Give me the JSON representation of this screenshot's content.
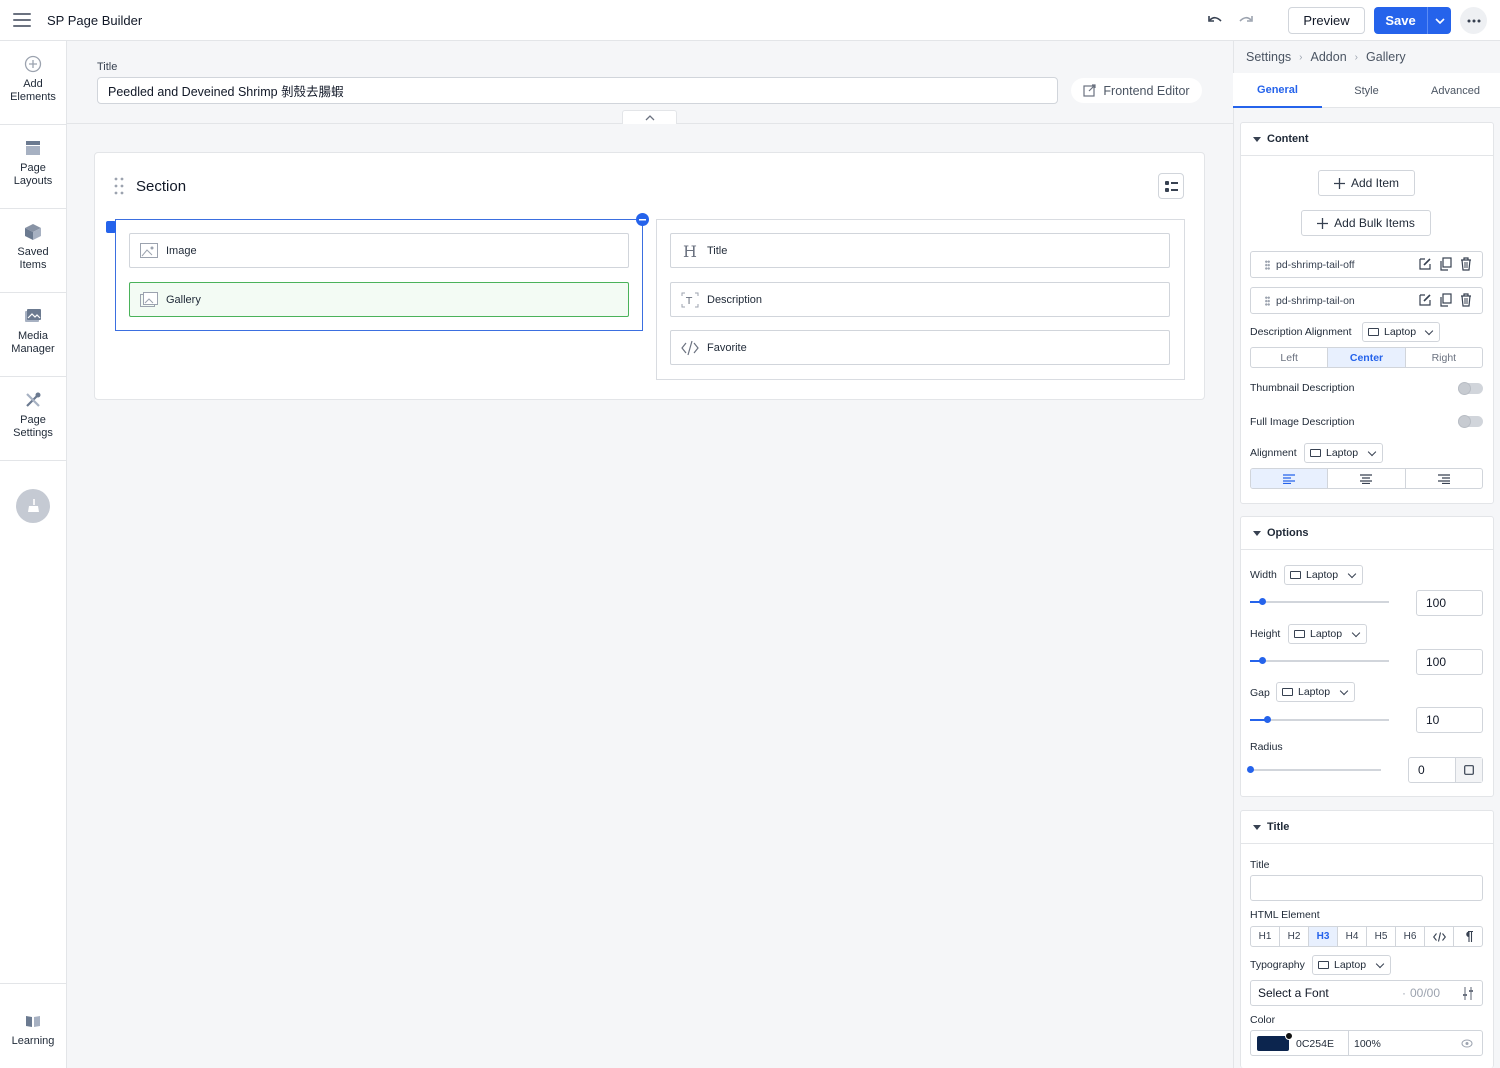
{
  "app": {
    "title": "SP Page Builder"
  },
  "toolbar": {
    "preview_label": "Preview",
    "save_label": "Save",
    "accent": "#2563eb"
  },
  "sidebar": {
    "items": [
      {
        "label": "Add Elements",
        "icon": "plus-circle-icon"
      },
      {
        "label": "Page Layouts",
        "icon": "layout-icon"
      },
      {
        "label": "Saved Items",
        "icon": "box-icon"
      },
      {
        "label": "Media Manager",
        "icon": "image-icon"
      },
      {
        "label": "Page Settings",
        "icon": "tools-icon"
      }
    ],
    "learning_label": "Learning"
  },
  "page": {
    "title_label": "Title",
    "title_value": "Peedled and Deveined Shrimp 剝殼去腸蝦",
    "frontend_editor_label": "Frontend Editor"
  },
  "section": {
    "title": "Section",
    "col1": [
      {
        "label": "Image"
      },
      {
        "label": "Gallery"
      }
    ],
    "col2": [
      {
        "label": "Title"
      },
      {
        "label": "Description"
      },
      {
        "label": "Favorite"
      }
    ]
  },
  "panel": {
    "breadcrumb": [
      "Settings",
      "Addon",
      "Gallery"
    ],
    "tabs": [
      "General",
      "Style",
      "Advanced"
    ],
    "content": {
      "heading": "Content",
      "add_item": "Add Item",
      "add_bulk": "Add Bulk Items",
      "items": [
        "pd-shrimp-tail-off",
        "pd-shrimp-tail-on"
      ],
      "desc_align_label": "Description Alignment",
      "device": "Laptop",
      "align_options": [
        "Left",
        "Center",
        "Right"
      ],
      "align_selected": "Center",
      "thumb_desc_label": "Thumbnail Description",
      "thumb_desc_on": false,
      "full_desc_label": "Full Image Description",
      "full_desc_on": false,
      "alignment_label": "Alignment",
      "alignment_selected": "left"
    },
    "options": {
      "heading": "Options",
      "width_label": "Width",
      "width_value": "100",
      "height_label": "Height",
      "height_value": "100",
      "gap_label": "Gap",
      "gap_value": "10",
      "radius_label": "Radius",
      "radius_value": "0"
    },
    "title_group": {
      "heading": "Title",
      "title_label": "Title",
      "title_value": "",
      "html_element_label": "HTML Element",
      "html_elements": [
        "H1",
        "H2",
        "H3",
        "H4",
        "H5",
        "H6"
      ],
      "html_selected": "H3",
      "typography_label": "Typography",
      "font_placeholder": "Select a Font",
      "font_size": "00/00",
      "color_label": "Color",
      "color_hex": "0C254E",
      "color_swatch": "#0C254E",
      "opacity": "100%"
    }
  }
}
